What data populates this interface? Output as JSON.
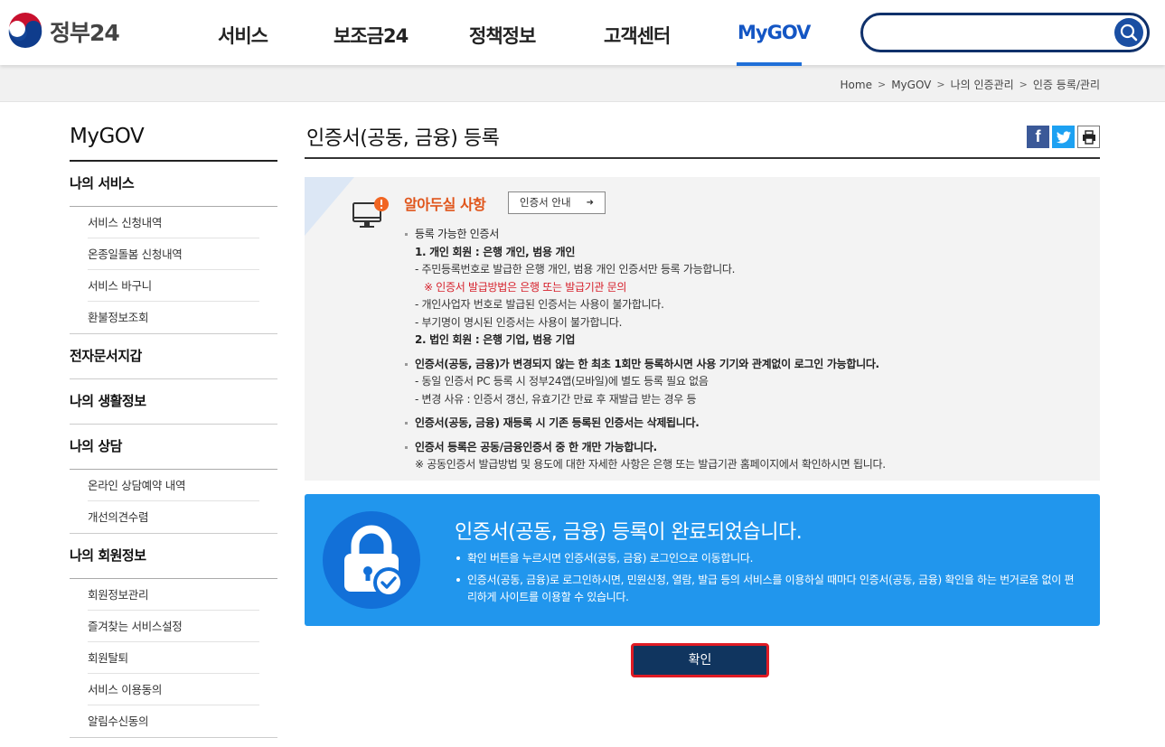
{
  "logo": {
    "text": "정부24"
  },
  "nav": {
    "items": [
      {
        "label": "서비스"
      },
      {
        "label": "보조금24"
      },
      {
        "label": "정책정보"
      },
      {
        "label": "고객센터"
      },
      {
        "label": "MyGOV",
        "active": true
      }
    ]
  },
  "search": {
    "value": "",
    "icon": "search-icon"
  },
  "breadcrumb": [
    "Home",
    "MyGOV",
    "나의 인증관리",
    "인증 등록/관리"
  ],
  "sidebar": {
    "title": "MyGOV",
    "groups": [
      {
        "title": "나의 서비스",
        "items": [
          "서비스 신청내역",
          "온종일돌봄 신청내역",
          "서비스 바구니",
          "환불정보조회"
        ]
      },
      {
        "title": "전자문서지갑",
        "items": []
      },
      {
        "title": "나의 생활정보",
        "items": []
      },
      {
        "title": "나의 상담",
        "items": [
          "온라인 상담예약 내역",
          "개선의견수렴"
        ]
      },
      {
        "title": "나의 회원정보",
        "items": [
          "회원정보관리",
          "즐겨찾는 서비스설정",
          "회원탈퇴",
          "서비스 이용동의",
          "알림수신동의"
        ]
      }
    ]
  },
  "page": {
    "title": "인증서(공동, 금융) 등록"
  },
  "notice": {
    "heading": "알아두실 사항",
    "guide_button": "인증서 안내",
    "s1_title": "등록 가능한 인증서",
    "s1_personal": "1. 개인 회원 : 은행 개인, 범용 개인",
    "s1_line1": "- 주민등록번호로 발급한 은행 개인, 범용 개인 인증서만 등록 가능합니다.",
    "s1_red": "※ 인증서 발급방법은 은행 또는 발급기관 문의",
    "s1_line2": "- 개인사업자 번호로 발급된 인증서는 사용이 불가합니다.",
    "s1_line3": "- 부기명이 명시된 인증서는 사용이 불가합니다.",
    "s1_corp": "2. 법인 회원 : 은행 기업, 범용 기업",
    "s2_title": "인증서(공동, 금융)가 변경되지 않는 한 최초 1회만 등록하시면 사용 기기와 관계없이 로그인 가능합니다.",
    "s2_line1": "- 동일 인증서 PC 등록 시 정부24앱(모바일)에 별도 등록 필요 없음",
    "s2_line2": "- 변경 사유 : 인증서 갱신, 유효기간 만료 후 재발급 받는 경우 등",
    "s3_title": "인증서(공동, 금융) 재등록 시 기존 등록된 인증서는 삭제됩니다.",
    "s4_title": "인증서 등록은 공동/금융인증서 중 한 개만 가능합니다.",
    "s4_line1": "※ 공동인증서 발급방법 및 용도에 대한 자세한 사항은 은행 또는 발급기관 홈페이지에서 확인하시면 됩니다."
  },
  "complete": {
    "title": "인증서(공동, 금융) 등록이 완료되었습니다.",
    "item1": "확인 버튼을 누르시면 인증서(공동, 금융) 로그인으로 이동합니다.",
    "item2": "인증서(공동, 금융)로 로그인하시면, 민원신청, 열람, 발급 등의 서비스를 이용하실 때마다 인증서(공동, 금융) 확인을 하는 번거로움 없이 편리하게 사이트를 이용할 수 있습니다."
  },
  "confirm_button": "확인",
  "colors": {
    "accent": "#1f6fd8",
    "notice_orange": "#e0551b",
    "complete_bg": "#2196ed",
    "button_bg": "#10355f",
    "button_border": "#e01b24"
  }
}
